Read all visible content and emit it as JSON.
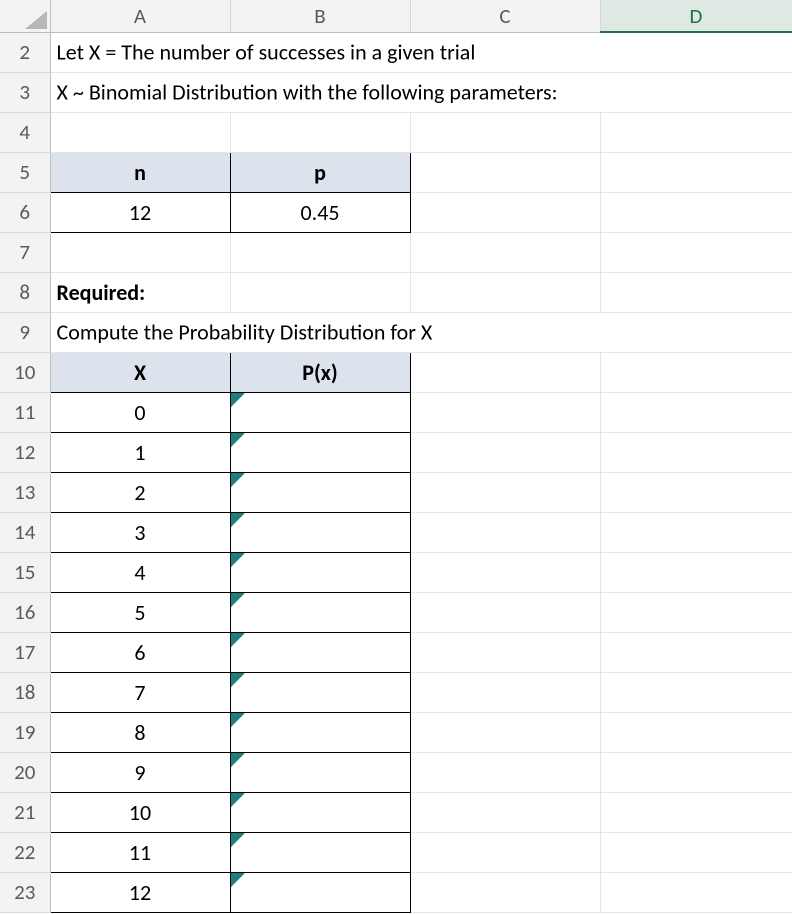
{
  "columns": {
    "A": "A",
    "B": "B",
    "C": "C",
    "D": "D"
  },
  "rows": [
    "2",
    "3",
    "4",
    "5",
    "6",
    "7",
    "8",
    "9",
    "10",
    "11",
    "12",
    "13",
    "14",
    "15",
    "16",
    "17",
    "18",
    "19",
    "20",
    "21",
    "22",
    "23"
  ],
  "text": {
    "r2": "Let X = The number of successes in a given trial",
    "r3": "X ~ Binomial Distribution with the following parameters:",
    "r8": "Required:",
    "r9": "Compute the Probability Distribution for X"
  },
  "param_table": {
    "headers": {
      "n": "n",
      "p": "p"
    },
    "values": {
      "n": "12",
      "p": "0.45"
    }
  },
  "dist_table": {
    "headers": {
      "x": "X",
      "px": "P(x)"
    },
    "x_values": [
      "0",
      "1",
      "2",
      "3",
      "4",
      "5",
      "6",
      "7",
      "8",
      "9",
      "10",
      "11",
      "12"
    ]
  }
}
